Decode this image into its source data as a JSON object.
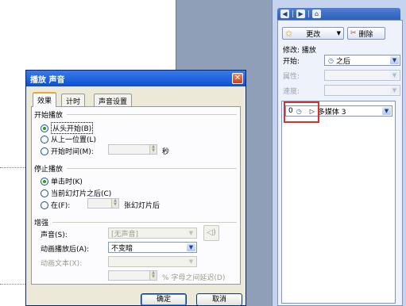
{
  "dialog": {
    "title": "播放 声音",
    "tabs": [
      "效果",
      "计时",
      "声音设置"
    ],
    "start_group": {
      "title": "开始播放",
      "options": [
        "从头开始(B)",
        "从上一位置(L)",
        "开始时间(M):"
      ],
      "seconds_unit": "秒"
    },
    "stop_group": {
      "title": "停止播放",
      "options": [
        "单击时(K)",
        "当前幻灯片之后(C)",
        "在(F):"
      ],
      "after_slides_label": "张幻灯片后"
    },
    "enhance_group": {
      "title": "增强",
      "sound_label": "声音(S):",
      "sound_value": "[无声音]",
      "after_anim_label": "动画播放后(A):",
      "after_anim_value": "不变暗",
      "anim_text_label": "动画文本(X):",
      "delay_label": "% 字母之间延迟(D)"
    },
    "ok_label": "确定",
    "cancel_label": "取消"
  },
  "taskpane": {
    "change_label": "更改",
    "delete_label": "删除",
    "modify_label": "修改: 播放",
    "start_label": "开始:",
    "start_value": "之后",
    "property_label": "属性:",
    "speed_label": "速度:",
    "effect_item": {
      "index": "0",
      "name": "多媒体 3"
    }
  },
  "icons": [
    "back-icon",
    "forward-icon",
    "home-icon",
    "star-icon",
    "delete-icon",
    "clock-icon",
    "play-icon",
    "speaker-icon",
    "close-icon",
    "chevron-down-icon"
  ]
}
